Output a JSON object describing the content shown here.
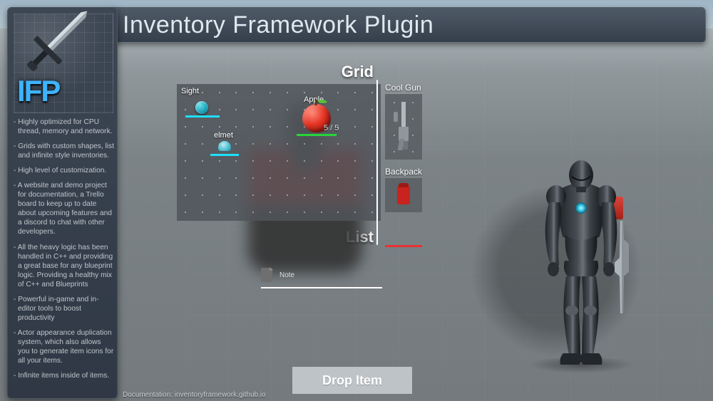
{
  "title": "Inventory Framework Plugin",
  "logo_text": "IFP",
  "features": [
    "Highly optimized for CPU thread, memory and network.",
    "Grids with custom shapes, list and infinite style inventories.",
    "High level of customization.",
    "A website and demo project for documentation, a Trello board to keep up to date about upcoming features and a discord to chat with other developers.",
    "All the heavy logic has been handled in C++ and providing a great base for any blueprint logic. Providing a healthy mix of C++ and Blueprints",
    "Powerful in-game and in-editor tools to boost productivity",
    "Actor appearance duplication system, which also allows you to generate item icons for all your items.",
    "Infinite items inside of items."
  ],
  "sections": {
    "grid": "Grid",
    "list": "List"
  },
  "grid_items": {
    "sight": {
      "label": "Sight"
    },
    "apple": {
      "label": "Apple",
      "count": "5 / 5"
    },
    "helmet": {
      "label": "elmet"
    }
  },
  "list_items": [
    {
      "label": "Note"
    }
  ],
  "equipment": {
    "gun": {
      "label": "Cool Gun"
    },
    "backpack": {
      "label": "Backpack"
    }
  },
  "drop_button": "Drop Item",
  "documentation": "Documentation: inventoryframework.github.io"
}
